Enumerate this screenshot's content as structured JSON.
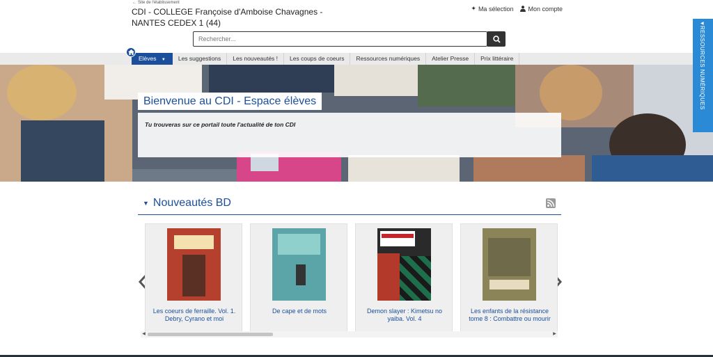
{
  "header": {
    "back_label": "Site de l'établissement",
    "title": "CDI - COLLEGE Françoise d'Amboise Chavagnes - NANTES CEDEX 1 (44)",
    "links": {
      "selection": "Ma sélection",
      "account": "Mon compte"
    },
    "search_placeholder": "Rechercher..."
  },
  "nav": {
    "active": "Elèves",
    "items": [
      "Les suggestions",
      "Les nouveautés !",
      "Les coups de coeurs",
      "Ressources numériques",
      "Atelier Presse",
      "Prix littéraire"
    ]
  },
  "side_tab": {
    "label": "RESSOURCES NUMÉRIQUES"
  },
  "banner": {
    "title": "Bienvenue au CDI - Espace élèves",
    "subtitle": "Tu trouveras sur ce portail toute l'actualité de ton CDI"
  },
  "section": {
    "title": "Nouveautés BD",
    "books": [
      {
        "label": "Les coeurs de ferraille. Vol. 1. Debry, Cyrano et moi",
        "cover_color": "#b5402d"
      },
      {
        "label": "De cape et de mots",
        "cover_color": "#5ba4a8"
      },
      {
        "label": "Demon slayer : Kimetsu no yaiba. Vol. 4",
        "cover_color": "#2a2a2a"
      },
      {
        "label": "Les enfants de la résistance tome 8 : Combattre ou mourir",
        "cover_color": "#8a8458"
      }
    ]
  },
  "colors": {
    "brand": "#1b4f9c",
    "side_tab": "#2b8ad6",
    "nav_bg": "#eaeaea"
  }
}
